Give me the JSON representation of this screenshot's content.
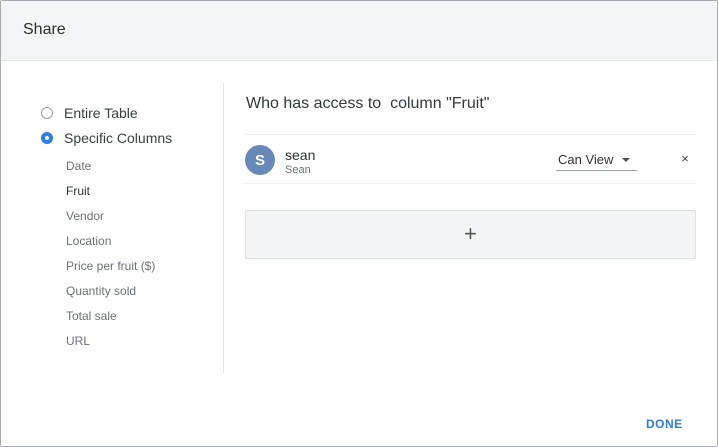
{
  "dialog": {
    "title": "Share",
    "done_label": "DONE"
  },
  "scope": {
    "options": [
      {
        "label": "Entire Table",
        "selected": false
      },
      {
        "label": "Specific Columns",
        "selected": true
      }
    ],
    "columns": [
      {
        "label": "Date",
        "active": false
      },
      {
        "label": "Fruit",
        "active": true
      },
      {
        "label": "Vendor",
        "active": false
      },
      {
        "label": "Location",
        "active": false
      },
      {
        "label": "Price per fruit ($)",
        "active": false
      },
      {
        "label": "Quantity sold",
        "active": false
      },
      {
        "label": "Total sale",
        "active": false
      },
      {
        "label": "URL",
        "active": false
      }
    ]
  },
  "access": {
    "heading": "Who has access to  column \"Fruit\"",
    "users": [
      {
        "initial": "S",
        "name": "sean",
        "display_name": "Sean",
        "permission": "Can View",
        "avatar_color": "#6889b8"
      }
    ],
    "remove_symbol": "×",
    "add_symbol": "+"
  },
  "colors": {
    "accent": "#2f7de1",
    "header_bg": "#f4f5f7"
  },
  "icons": {
    "remove": "close-icon",
    "add": "plus-icon",
    "dropdown": "caret-down-icon"
  }
}
